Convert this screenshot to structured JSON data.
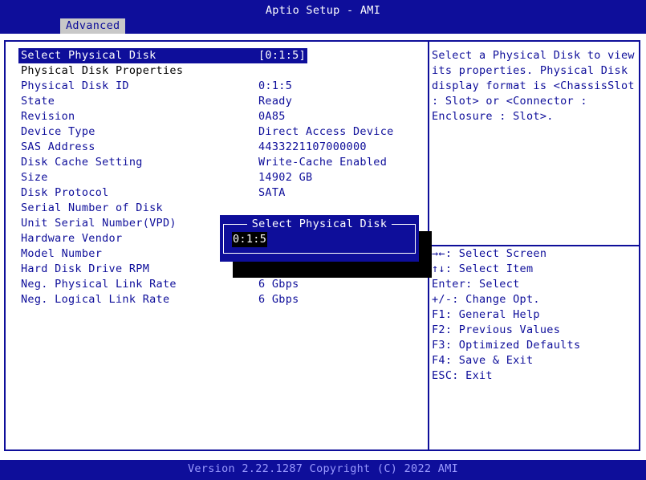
{
  "header": {
    "title": "Aptio Setup - AMI",
    "tab": "Advanced"
  },
  "main": {
    "rows": [
      {
        "label": "Select Physical Disk",
        "value": "[0:1:5]"
      },
      {
        "label": "Physical Disk Properties",
        "value": ""
      },
      {
        "label": "Physical Disk ID",
        "value": "0:1:5"
      },
      {
        "label": "State",
        "value": "Ready"
      },
      {
        "label": "Revision",
        "value": "0A85"
      },
      {
        "label": "Device Type",
        "value": "Direct Access Device"
      },
      {
        "label": "SAS Address",
        "value": "4433221107000000"
      },
      {
        "label": "Disk Cache Setting",
        "value": "Write-Cache Enabled"
      },
      {
        "label": "Size",
        "value": "14902 GB"
      },
      {
        "label": "Disk Protocol",
        "value": "SATA"
      },
      {
        "label": "Serial Number of Disk",
        "value": ""
      },
      {
        "label": "Unit Serial Number(VPD)",
        "value": ""
      },
      {
        "label": "Hardware Vendor",
        "value": ""
      },
      {
        "label": "Model Number",
        "value": ""
      },
      {
        "label": "Hard Disk Drive RPM",
        "value": ""
      },
      {
        "label": "Neg. Physical Link Rate",
        "value": "6 Gbps"
      },
      {
        "label": "Neg. Logical Link Rate",
        "value": "6 Gbps"
      }
    ]
  },
  "help": {
    "lines": [
      "Select a Physical Disk to view",
      "its properties. Physical Disk",
      "display format is <ChassisSlot",
      ": Slot> or <Connector :",
      "Enclosure : Slot>."
    ]
  },
  "keys": {
    "lines": [
      "→←: Select Screen",
      "↑↓: Select Item",
      "Enter: Select",
      "+/-: Change Opt.",
      "F1: General Help",
      "F2: Previous Values",
      "F3: Optimized Defaults",
      "F4: Save & Exit",
      "ESC: Exit"
    ]
  },
  "popup": {
    "title": "Select Physical Disk",
    "value": "0:1:5"
  },
  "footer": {
    "text": "Version 2.22.1287 Copyright (C) 2022 AMI"
  }
}
